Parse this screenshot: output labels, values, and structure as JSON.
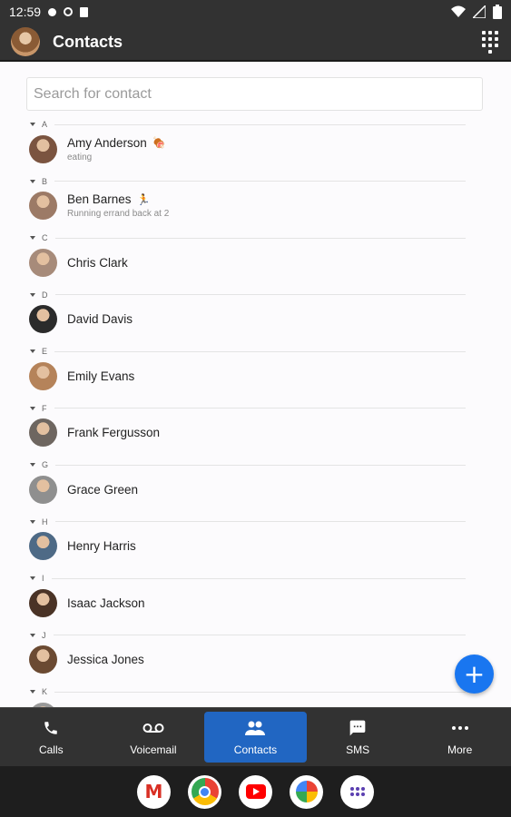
{
  "status_bar": {
    "time": "12:59"
  },
  "app_bar": {
    "title": "Contacts"
  },
  "search": {
    "placeholder": "Search for contact"
  },
  "sections": [
    {
      "letter": "A",
      "contact": {
        "name": "Amy Anderson",
        "emoji": "🍖",
        "status": "eating",
        "avatar_color": "#7b5440"
      }
    },
    {
      "letter": "B",
      "contact": {
        "name": "Ben Barnes",
        "emoji": "🏃",
        "status": "Running errand back at 2",
        "avatar_color": "#9c7a66"
      }
    },
    {
      "letter": "C",
      "contact": {
        "name": "Chris Clark",
        "emoji": "",
        "status": "",
        "avatar_color": "#a78b7a"
      }
    },
    {
      "letter": "D",
      "contact": {
        "name": "David Davis",
        "emoji": "",
        "status": "",
        "avatar_color": "#2b2b2b"
      }
    },
    {
      "letter": "E",
      "contact": {
        "name": "Emily Evans",
        "emoji": "",
        "status": "",
        "avatar_color": "#b5835a"
      }
    },
    {
      "letter": "F",
      "contact": {
        "name": "Frank Fergusson",
        "emoji": "",
        "status": "",
        "avatar_color": "#6e6660"
      }
    },
    {
      "letter": "G",
      "contact": {
        "name": "Grace Green",
        "emoji": "",
        "status": "",
        "avatar_color": "#8f8f8f"
      }
    },
    {
      "letter": "H",
      "contact": {
        "name": "Henry Harris",
        "emoji": "",
        "status": "",
        "avatar_color": "#4e6a86"
      }
    },
    {
      "letter": "I",
      "contact": {
        "name": "Isaac Jackson",
        "emoji": "",
        "status": "",
        "avatar_color": "#4a3326"
      }
    },
    {
      "letter": "J",
      "contact": {
        "name": "Jessica Jones",
        "emoji": "",
        "status": "",
        "avatar_color": "#6b4a32"
      }
    },
    {
      "letter": "K",
      "contact": {
        "name": "",
        "emoji": "",
        "status": "",
        "avatar_color": "#999999"
      }
    }
  ],
  "bottom_nav": [
    {
      "label": "Calls",
      "icon": "phone-icon"
    },
    {
      "label": "Voicemail",
      "icon": "voicemail-icon"
    },
    {
      "label": "Contacts",
      "icon": "people-icon",
      "active": true
    },
    {
      "label": "SMS",
      "icon": "message-icon"
    },
    {
      "label": "More",
      "icon": "more-horiz-icon"
    }
  ],
  "dock_apps": [
    "gmail-icon",
    "chrome-icon",
    "youtube-icon",
    "photos-icon",
    "app-drawer-icon"
  ],
  "colors": {
    "bar": "#323232",
    "accent": "#1976f0",
    "active_nav": "#2166c2",
    "background": "#fcfbfd"
  }
}
